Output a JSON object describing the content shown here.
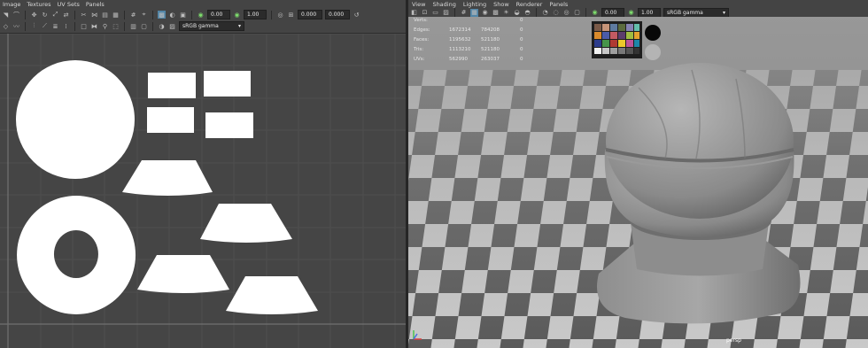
{
  "uv_editor": {
    "menus": [
      "Image",
      "Textures",
      "UV Sets",
      "Panels"
    ],
    "field_a": "0.00",
    "field_b": "1.00",
    "field_c": "0.000",
    "field_d": "0.000",
    "colorspace": "sRGB gamma"
  },
  "viewport": {
    "menus": [
      "View",
      "Shading",
      "Lighting",
      "Show",
      "Renderer",
      "Panels"
    ],
    "field_a": "0.00",
    "field_b": "1.00",
    "colorspace": "sRGB gamma",
    "hud": [
      {
        "label": "Verts:",
        "value": "",
        "tri": "0"
      },
      {
        "label": "Edges:",
        "value": "1672314",
        "tri_count": "784208",
        "tri": "0"
      },
      {
        "label": "Faces:",
        "value": "1195632",
        "tri_count": "521180",
        "tri": "0"
      },
      {
        "label": "Tris:",
        "value": "1113210",
        "tri_count": "521180",
        "tri": "0"
      },
      {
        "label": "UVs:",
        "value": "562990",
        "tri_count": "263037",
        "tri": "0"
      }
    ],
    "camera": "persp"
  },
  "colors": {
    "accent": "#5285a6",
    "uv_shell": "#ffffff",
    "grid_bg": "#444444"
  }
}
